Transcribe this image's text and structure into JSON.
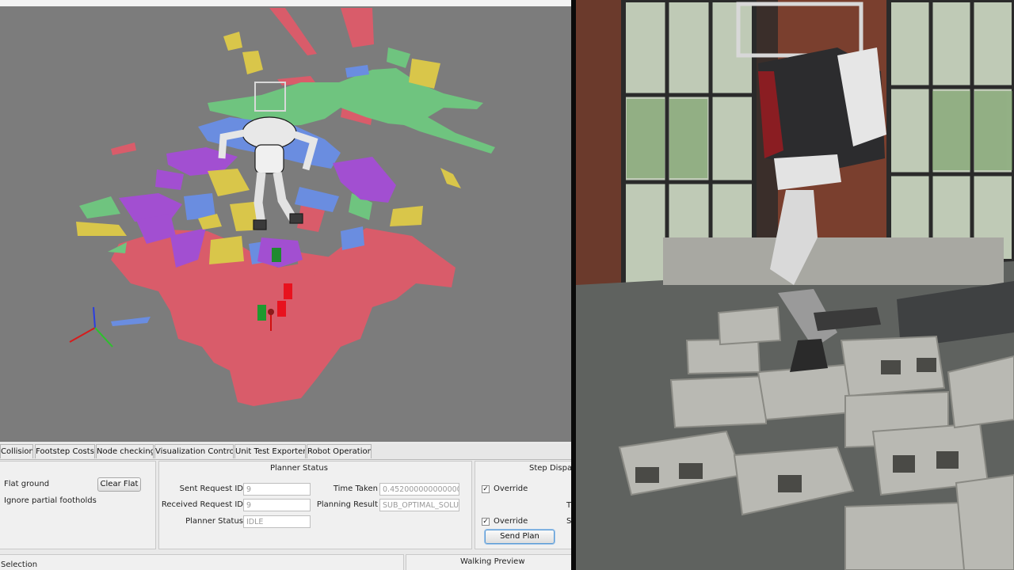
{
  "tabs": [
    "Collisions",
    "Footstep Costs",
    "Node checking",
    "Visualization Control",
    "Unit Test Exporter",
    "Robot Operation"
  ],
  "left_panel": {
    "flat_ground_label": "Flat ground",
    "clear_flat_label": "Clear Flat",
    "ignore_partial_label": "Ignore partial footholds"
  },
  "planner_status": {
    "title": "Planner Status",
    "sent_request_id_label": "Sent Request ID",
    "sent_request_id_value": "9",
    "received_request_id_label": "Received Request ID",
    "received_request_id_value": "9",
    "planner_status_label": "Planner Status",
    "planner_status_value": "IDLE",
    "time_taken_label": "Time Taken",
    "time_taken_value": "0.452000000000000",
    "planning_result_label": "Planning Result",
    "planning_result_value": "SUB_OPTIMAL_SOLU"
  },
  "step_dispatch": {
    "title": "Step Dispat",
    "override_1_label": "Override",
    "override_2_label": "Override",
    "cut_t": "T",
    "cut_s": "S",
    "send_plan_label": "Send Plan"
  },
  "bottom": {
    "selection_label": "Selection",
    "walking_preview_label": "Walking Preview"
  },
  "colors": {
    "viewport_bg": "#7c7c7c",
    "region_red": "#d95c6a",
    "region_green": "#6fc47f",
    "region_blue": "#6a8de0",
    "region_purple": "#a24fd1",
    "region_yellow": "#d9c64a",
    "focus_border": "#5b9bd5"
  },
  "icons": [
    "axis-triad-icon",
    "start-pose-icon",
    "goal-pose-icon",
    "checkmark-icon"
  ]
}
